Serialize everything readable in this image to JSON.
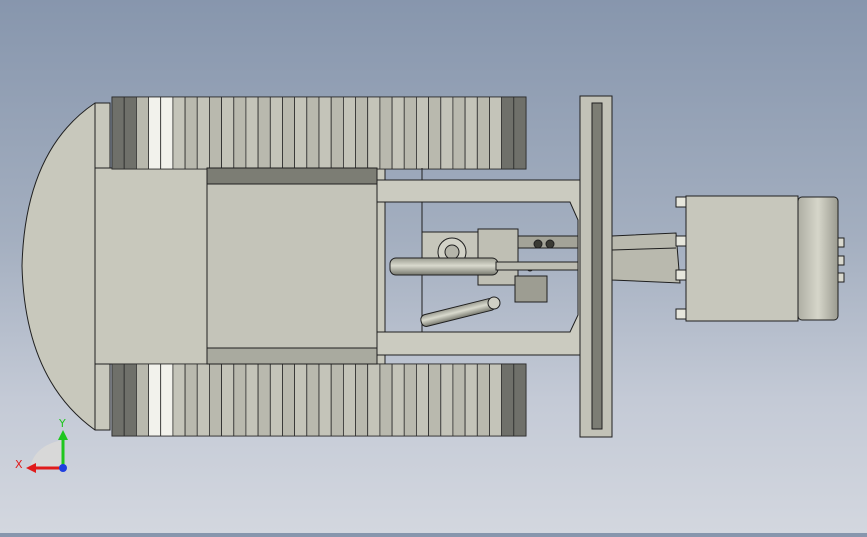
{
  "viewport": {
    "background_top": "#8796ad",
    "background_bottom": "#d3d7df"
  },
  "model": {
    "body_color": "#c8c8bc",
    "dark_panel_color": "#7c7d74",
    "mid_panel_color": "#a9aa9f",
    "edge_color": "#1f1f1f",
    "track_links": 34
  },
  "triad": {
    "x_label": "X",
    "y_label": "Y",
    "x_color": "#e01b1b",
    "y_color": "#1fc61f",
    "z_color": "#1f3fe0"
  }
}
